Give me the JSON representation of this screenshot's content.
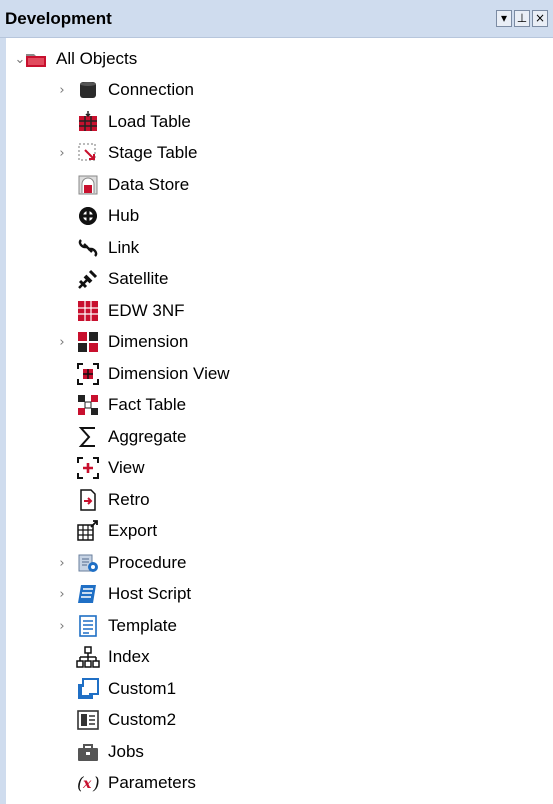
{
  "panel": {
    "title": "Development",
    "controls": {
      "dropdown": "▾",
      "pin": "⊥",
      "close": "×"
    }
  },
  "tree": {
    "root": {
      "label": "All Objects",
      "expanded": true
    },
    "items": [
      {
        "label": "Connection",
        "icon": "connection-icon",
        "expandable": true
      },
      {
        "label": "Load Table",
        "icon": "load-table-icon",
        "expandable": false
      },
      {
        "label": "Stage Table",
        "icon": "stage-table-icon",
        "expandable": true
      },
      {
        "label": "Data Store",
        "icon": "data-store-icon",
        "expandable": false
      },
      {
        "label": "Hub",
        "icon": "hub-icon",
        "expandable": false
      },
      {
        "label": "Link",
        "icon": "link-icon",
        "expandable": false
      },
      {
        "label": "Satellite",
        "icon": "satellite-icon",
        "expandable": false
      },
      {
        "label": "EDW 3NF",
        "icon": "edw-3nf-icon",
        "expandable": false
      },
      {
        "label": "Dimension",
        "icon": "dimension-icon",
        "expandable": true
      },
      {
        "label": "Dimension View",
        "icon": "dimension-view-icon",
        "expandable": false
      },
      {
        "label": "Fact Table",
        "icon": "fact-table-icon",
        "expandable": false
      },
      {
        "label": "Aggregate",
        "icon": "aggregate-icon",
        "expandable": false
      },
      {
        "label": "View",
        "icon": "view-icon",
        "expandable": false
      },
      {
        "label": "Retro",
        "icon": "retro-icon",
        "expandable": false
      },
      {
        "label": "Export",
        "icon": "export-icon",
        "expandable": false
      },
      {
        "label": "Procedure",
        "icon": "procedure-icon",
        "expandable": true
      },
      {
        "label": "Host Script",
        "icon": "host-script-icon",
        "expandable": true
      },
      {
        "label": "Template",
        "icon": "template-icon",
        "expandable": true
      },
      {
        "label": "Index",
        "icon": "index-icon",
        "expandable": false
      },
      {
        "label": "Custom1",
        "icon": "custom1-icon",
        "expandable": false
      },
      {
        "label": "Custom2",
        "icon": "custom2-icon",
        "expandable": false
      },
      {
        "label": "Jobs",
        "icon": "jobs-icon",
        "expandable": false
      },
      {
        "label": "Parameters",
        "icon": "parameters-icon",
        "expandable": false
      }
    ]
  },
  "colors": {
    "header": "#cfdcee",
    "accent_red": "#c8102e",
    "accent_blue": "#1f6fc5"
  }
}
